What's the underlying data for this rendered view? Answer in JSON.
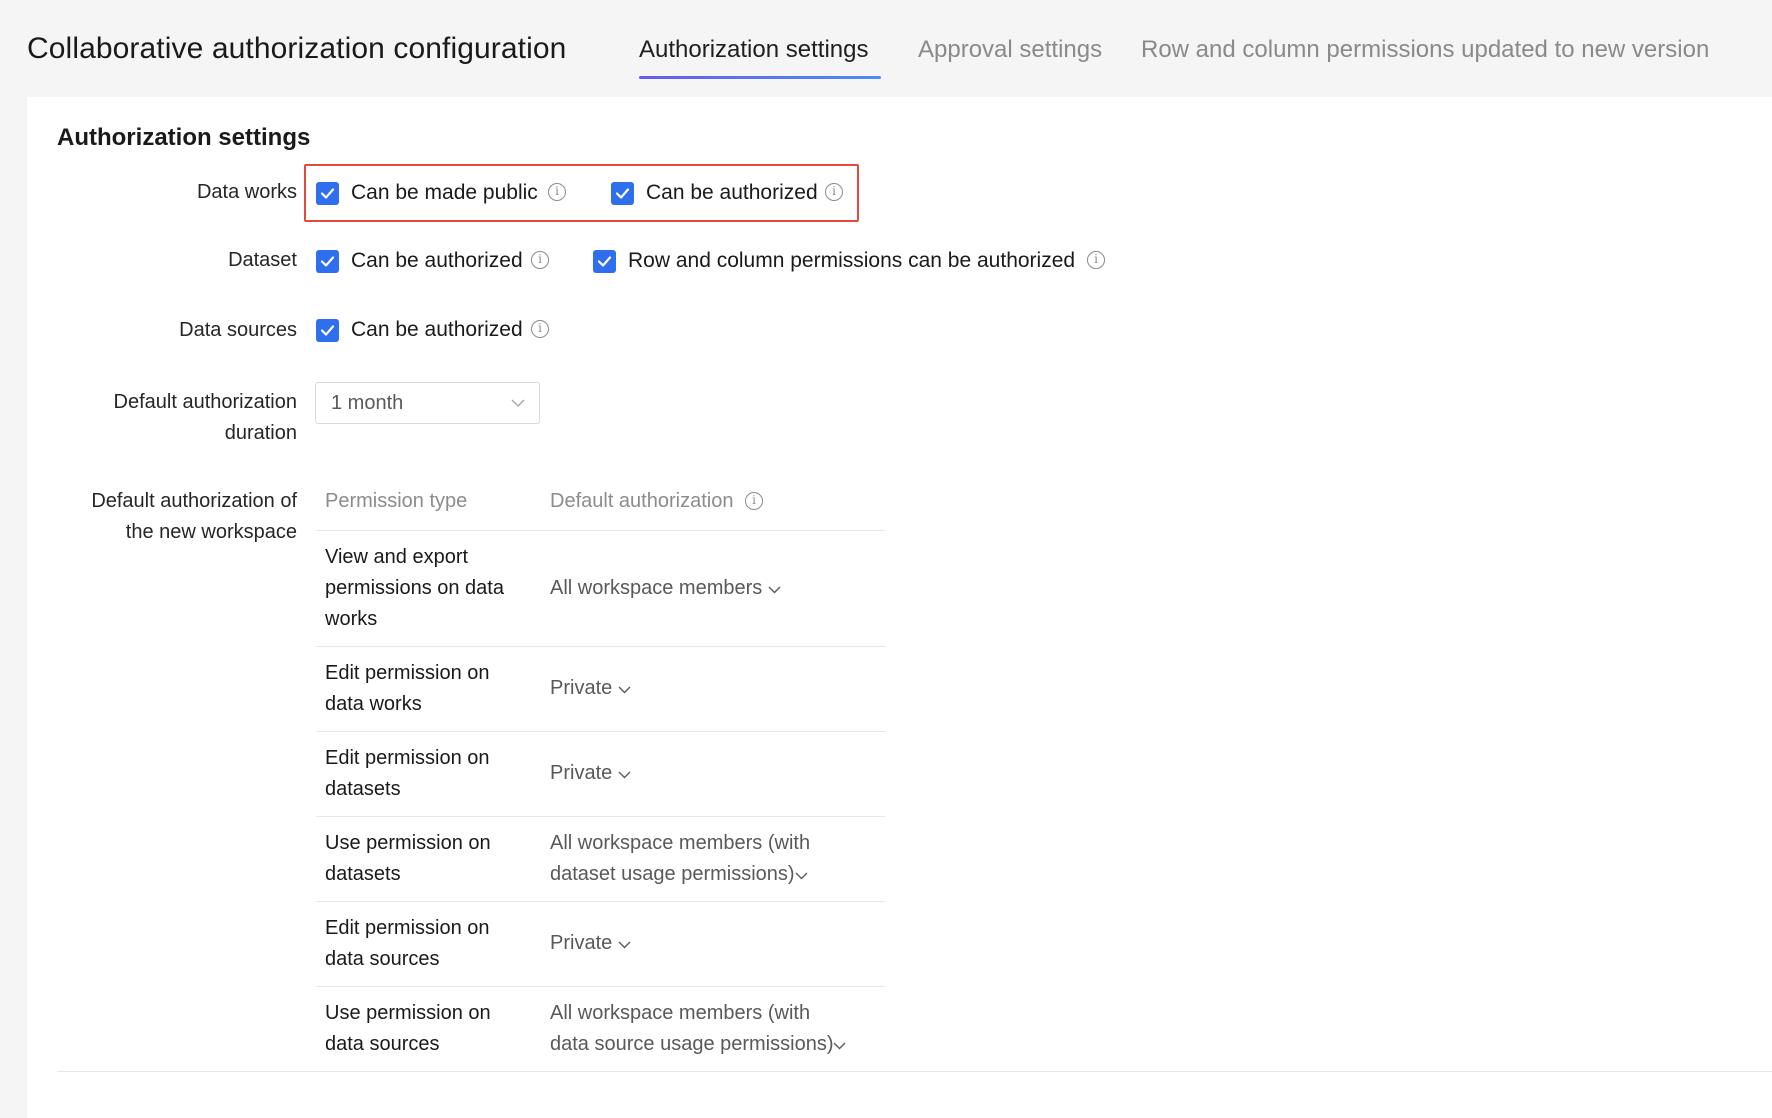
{
  "header": {
    "title": "Collaborative authorization configuration",
    "tabs": [
      {
        "label": "Authorization settings",
        "active": true
      },
      {
        "label": "Approval settings",
        "active": false
      },
      {
        "label": "Row and column permissions updated to new version",
        "active": false
      }
    ]
  },
  "section_title": "Authorization settings",
  "rows": {
    "data_works": {
      "label": "Data works",
      "options": [
        {
          "label": "Can be made public",
          "checked": true
        },
        {
          "label": "Can be authorized",
          "checked": true
        }
      ]
    },
    "dataset": {
      "label": "Dataset",
      "options": [
        {
          "label": "Can be authorized",
          "checked": true
        },
        {
          "label": "Row and column permissions can be authorized",
          "checked": true
        }
      ]
    },
    "data_sources": {
      "label": "Data sources",
      "options": [
        {
          "label": "Can be authorized",
          "checked": true
        }
      ]
    },
    "duration": {
      "label_line1": "Default authorization",
      "label_line2": "duration",
      "value": "1 month"
    },
    "workspace": {
      "label_line1": "Default authorization of",
      "label_line2": "the new workspace"
    }
  },
  "table": {
    "headers": {
      "type": "Permission type",
      "default": "Default authorization"
    },
    "rows": [
      {
        "type": [
          "View and export",
          "permissions on data",
          "works"
        ],
        "value": [
          "All workspace members"
        ]
      },
      {
        "type": [
          "Edit permission on",
          "data works"
        ],
        "value": [
          "Private"
        ]
      },
      {
        "type": [
          "Edit permission on",
          "datasets"
        ],
        "value": [
          "Private"
        ]
      },
      {
        "type": [
          "Use permission on",
          "datasets"
        ],
        "value": [
          "All workspace members (with",
          "dataset usage permissions)"
        ]
      },
      {
        "type": [
          "Edit permission on",
          "data sources"
        ],
        "value": [
          "Private"
        ]
      },
      {
        "type": [
          "Use permission on",
          "data sources"
        ],
        "value": [
          "All workspace members (with",
          "data source usage permissions)"
        ]
      }
    ]
  },
  "colors": {
    "accent": "#2f6fed",
    "highlight_border": "#e5483c",
    "tab_gradient_start": "#6b5ce7",
    "tab_gradient_end": "#4a8ef2"
  }
}
